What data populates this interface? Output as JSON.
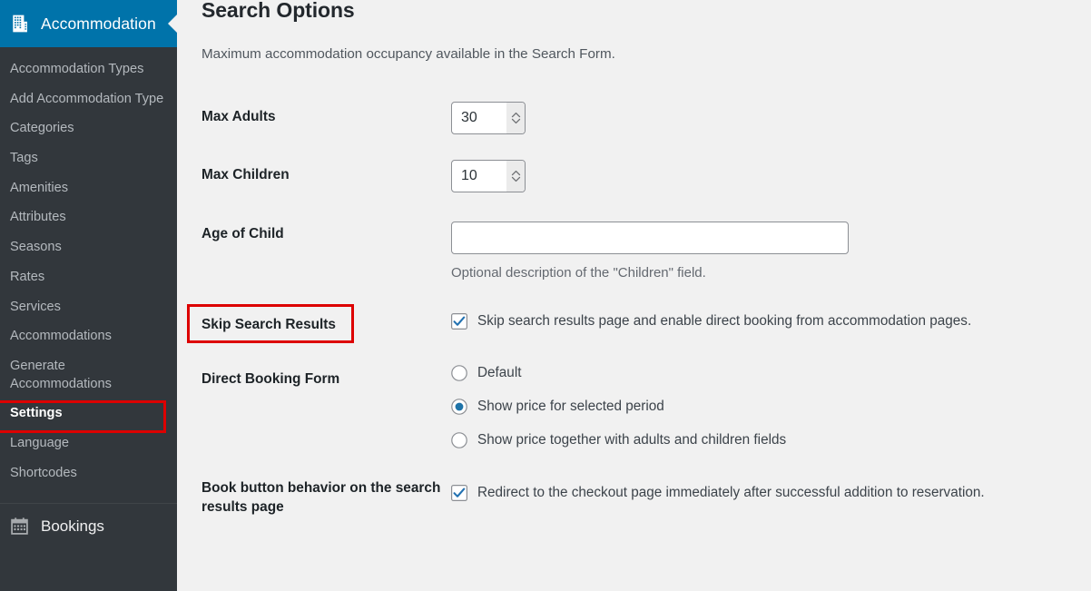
{
  "sidebar": {
    "top_menu": {
      "label": "Accommodation",
      "icon": "building-icon",
      "active_color": "#0073aa"
    },
    "items": [
      {
        "label": "Accommodation Types",
        "name": "accommodation-types"
      },
      {
        "label": "Add Accommodation Type",
        "name": "add-accommodation-type"
      },
      {
        "label": "Categories",
        "name": "categories"
      },
      {
        "label": "Tags",
        "name": "tags"
      },
      {
        "label": "Amenities",
        "name": "amenities"
      },
      {
        "label": "Attributes",
        "name": "attributes"
      },
      {
        "label": "Seasons",
        "name": "seasons"
      },
      {
        "label": "Rates",
        "name": "rates"
      },
      {
        "label": "Services",
        "name": "services"
      },
      {
        "label": "Accommodations",
        "name": "accommodations"
      },
      {
        "label": "Generate Accommodations",
        "name": "generate-accommodations"
      },
      {
        "label": "Settings",
        "name": "settings",
        "highlighted": true
      },
      {
        "label": "Language",
        "name": "language"
      },
      {
        "label": "Shortcodes",
        "name": "shortcodes"
      }
    ],
    "bottom_menu": {
      "label": "Bookings",
      "icon": "calendar-icon"
    }
  },
  "main": {
    "heading": "Search Options",
    "intro": "Maximum accommodation occupancy available in the Search Form.",
    "fields": {
      "max_adults": {
        "label": "Max Adults",
        "value": "30"
      },
      "max_children": {
        "label": "Max Children",
        "value": "10"
      },
      "age_of_child": {
        "label": "Age of Child",
        "value": "",
        "placeholder": "",
        "description": "Optional description of the \"Children\" field."
      },
      "skip_search_results": {
        "label": "Skip Search Results",
        "highlighted": true,
        "checkbox_label": "Skip search results page and enable direct booking from accommodation pages.",
        "checked": true
      },
      "direct_booking_form": {
        "label": "Direct Booking Form",
        "options": [
          {
            "label": "Default",
            "selected": false
          },
          {
            "label": "Show price for selected period",
            "selected": true
          },
          {
            "label": "Show price together with adults and children fields",
            "selected": false
          }
        ]
      },
      "book_button_behavior": {
        "label": "Book button behavior on the search results page",
        "checkbox_label": "Redirect to the checkout page immediately after successful addition to reservation.",
        "checked": true
      }
    }
  },
  "colors": {
    "sidebar_bg": "#32373c",
    "accent_blue": "#0073aa",
    "highlight_red": "#dd0000",
    "page_bg": "#f1f1f1",
    "control_accent": "#1e73a8"
  }
}
